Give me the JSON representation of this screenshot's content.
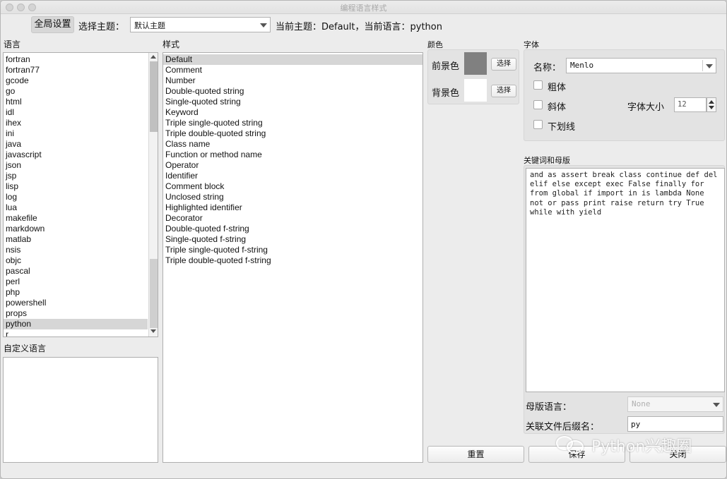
{
  "window": {
    "title": "编程语言样式"
  },
  "toolbar": {
    "global_settings": "全局设置",
    "select_theme_label": "选择主题：",
    "theme_value": "默认主题",
    "current_status": "当前主题：Default，当前语言：python"
  },
  "languages": {
    "title": "语言",
    "items": [
      "fortran",
      "fortran77",
      "gcode",
      "go",
      "html",
      "idl",
      "ihex",
      "ini",
      "java",
      "javascript",
      "json",
      "jsp",
      "lisp",
      "log",
      "lua",
      "makefile",
      "markdown",
      "matlab",
      "nsis",
      "objc",
      "pascal",
      "perl",
      "php",
      "powershell",
      "props",
      "python",
      "r"
    ],
    "selected": "python"
  },
  "custom_languages": {
    "title": "自定义语言"
  },
  "styles": {
    "title": "样式",
    "items": [
      "Default",
      "Comment",
      "Number",
      "Double-quoted string",
      "Single-quoted string",
      "Keyword",
      "Triple single-quoted string",
      "Triple double-quoted string",
      "Class name",
      "Function or method name",
      "Operator",
      "Identifier",
      "Comment block",
      "Unclosed string",
      "Highlighted identifier",
      "Decorator",
      "Double-quoted f-string",
      "Single-quoted f-string",
      "Triple single-quoted f-string",
      "Triple double-quoted f-string"
    ],
    "selected": "Default"
  },
  "color": {
    "title": "颜色",
    "foreground_label": "前景色",
    "background_label": "背景色",
    "choose": "选择",
    "foreground_color": "#808080",
    "background_color": "#ffffff"
  },
  "font": {
    "title": "字体",
    "name_label": "名称：",
    "name_value": "Menlo",
    "bold": "粗体",
    "italic": "斜体",
    "underline": "下划线",
    "size_label": "字体大小",
    "size_value": "12"
  },
  "keywords": {
    "title": "关键词和母版",
    "text": "and as assert break class continue def del elif else except exec False finally for from global if import in is lambda None not or pass print raise return try True while with yield",
    "template_label": "母版语言：",
    "template_value": "None",
    "suffix_label": "关联文件后缀名：",
    "suffix_value": "py"
  },
  "buttons": {
    "reset": "重置",
    "save": "保存",
    "close": "关闭"
  },
  "watermark": {
    "text": "Python兴趣圈"
  }
}
